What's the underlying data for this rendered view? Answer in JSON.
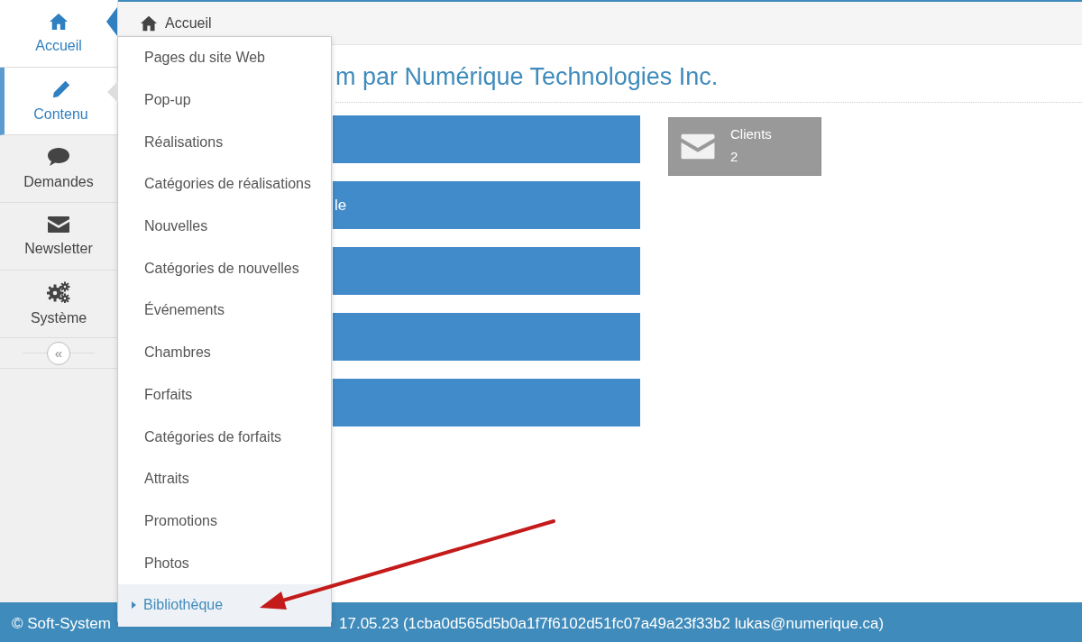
{
  "sidebar": {
    "items": [
      {
        "label": "Accueil",
        "kind": "home",
        "selected": true,
        "expanded": false
      },
      {
        "label": "Contenu",
        "kind": "pencil",
        "selected": false,
        "expanded": true
      },
      {
        "label": "Demandes",
        "kind": "chat",
        "selected": false,
        "expanded": false
      },
      {
        "label": "Newsletter",
        "kind": "envelope",
        "selected": false,
        "expanded": false
      },
      {
        "label": "Système",
        "kind": "gears",
        "selected": false,
        "expanded": false
      }
    ],
    "collapse": "«"
  },
  "breadcrumb": {
    "label": "Accueil"
  },
  "title": "m par Numérique Technologies Inc.",
  "shortcuts": [
    {
      "kind": "blank"
    },
    {
      "kind": "label",
      "label": "le"
    },
    {
      "kind": "blank"
    },
    {
      "kind": "blank"
    },
    {
      "kind": "blank"
    }
  ],
  "stat_card": {
    "label": "Clients",
    "value": "2"
  },
  "menu": {
    "items": [
      {
        "label": "Pages du site Web",
        "selected": false
      },
      {
        "label": "Pop-up",
        "selected": false
      },
      {
        "label": "Réalisations",
        "selected": false
      },
      {
        "label": "Catégories de réalisations",
        "selected": false
      },
      {
        "label": "Nouvelles",
        "selected": false
      },
      {
        "label": "Catégories de nouvelles",
        "selected": false
      },
      {
        "label": "Événements",
        "selected": false
      },
      {
        "label": "Chambres",
        "selected": false
      },
      {
        "label": "Forfaits",
        "selected": false
      },
      {
        "label": "Catégories de forfaits",
        "selected": false
      },
      {
        "label": "Attraits",
        "selected": false
      },
      {
        "label": "Promotions",
        "selected": false
      },
      {
        "label": "Photos",
        "selected": false
      },
      {
        "label": "Bibliothèque",
        "selected": true
      }
    ]
  },
  "footer": {
    "left": "© Soft-System",
    "right": "17.05.23 (1cba0d565d5b0a1f7f6102d51fc07a49a23f33b2 lukas@numerique.ca)"
  }
}
